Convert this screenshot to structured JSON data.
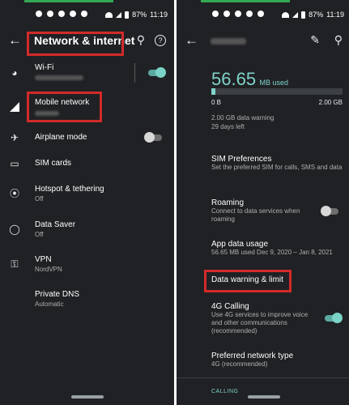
{
  "left": {
    "status": {
      "battery": "87%",
      "time": "11:19"
    },
    "header": {
      "title": "Network & internet"
    },
    "items": [
      {
        "label": "Wi-Fi"
      },
      {
        "label": "Mobile network"
      },
      {
        "label": "Airplane mode"
      },
      {
        "label": "SIM cards"
      },
      {
        "label": "Hotspot & tethering",
        "sub": "Off"
      },
      {
        "label": "Data Saver",
        "sub": "Off"
      },
      {
        "label": "VPN",
        "sub": "NordVPN"
      },
      {
        "label": "Private DNS",
        "sub": "Automatic"
      }
    ],
    "toggles": {
      "wifi": "on",
      "airplane": "off"
    }
  },
  "right": {
    "status": {
      "battery": "87%",
      "time": "11:19"
    },
    "usage": {
      "value": "56.65",
      "unit": "MB used",
      "min": "0 B",
      "max": "2.00 GB",
      "fill_fraction": 0.03
    },
    "warning": "2.00 GB data warning",
    "days_left": "29 days left",
    "items": [
      {
        "title": "SIM Preferences",
        "sub": "Set the preferred SIM for calls, SMS and data"
      },
      {
        "title": "Roaming",
        "sub": "Connect to data services when roaming"
      },
      {
        "title": "App data usage",
        "sub": "56.65 MB used Dec 9, 2020 – Jan 8, 2021"
      },
      {
        "title": "Data warning & limit",
        "sub": ""
      },
      {
        "title": "4G Calling",
        "sub": "Use 4G services to improve voice and other communications (recommended)"
      },
      {
        "title": "Preferred network type",
        "sub": "4G (recommended)"
      }
    ],
    "bottom_label": "CALLING",
    "toggles": {
      "roaming": "off",
      "calling_4g": "on"
    }
  }
}
